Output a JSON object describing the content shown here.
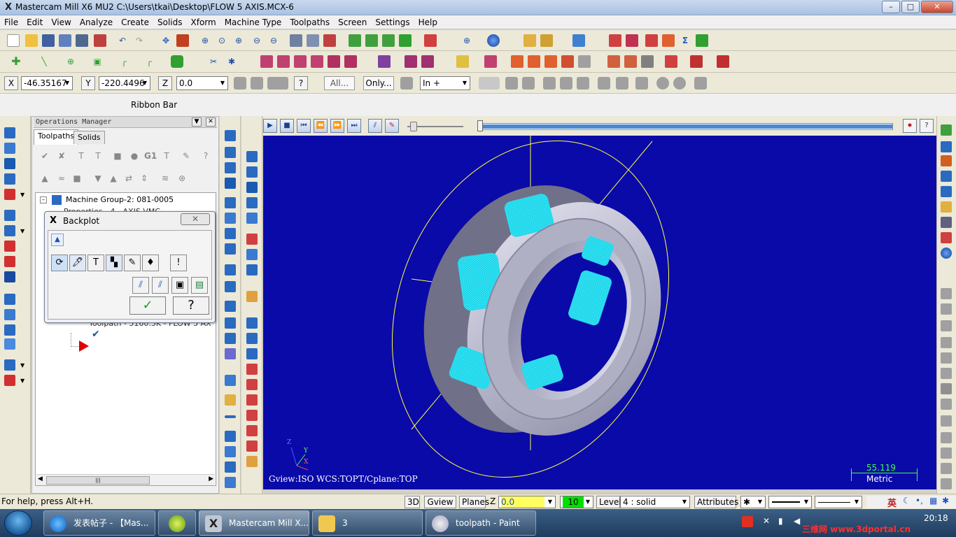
{
  "window": {
    "title": "Mastercam Mill X6 MU2  C:\\Users\\tkai\\Desktop\\FLOW 5 AXIS.MCX-6",
    "minimize": "–",
    "maximize": "□",
    "close": "✕"
  },
  "menu": [
    "File",
    "Edit",
    "View",
    "Analyze",
    "Create",
    "Solids",
    "Xform",
    "Machine Type",
    "Toolpaths",
    "Screen",
    "Settings",
    "Help"
  ],
  "ribbon": {
    "x_label": "X",
    "x_value": "-46.35167",
    "y_label": "Y",
    "y_value": "-220.4496",
    "z_label": "Z",
    "z_value": "0.0",
    "all_button": "All...",
    "only_button": "Only...",
    "mode_value": "In +",
    "help_icon": "?"
  },
  "ribbon_bar_label": "Ribbon Bar",
  "ops_manager": {
    "title": "Operations Manager",
    "tabs": [
      "Toolpaths",
      "Solids"
    ],
    "tree": {
      "machine_group": "Machine Group-2: 081-0005",
      "properties": "Properties - 4 - AXIS VMC",
      "toolpath": "Toolpath - 5160.5K - FLOW 5 AX"
    }
  },
  "backplot": {
    "title": "Backplot",
    "close": "✕",
    "info": "!",
    "ok": "✓",
    "help": "?"
  },
  "viewport": {
    "gview": "Gview:ISO",
    "wcs": "WCS:TOP",
    "tcplane": "T/Cplane:TOP",
    "scale_value": "55.119",
    "scale_unit": "Metric",
    "axis_z": "Z",
    "axis_y": "Y",
    "axis_x": "X",
    "colors": {
      "background": "#0a0aa8",
      "part": "#c8c8d8",
      "toolpath": "#00e0f0",
      "boundary": "#ffff40"
    }
  },
  "statusbar": {
    "help": "For help, press Alt+H.",
    "btn_3d": "3D",
    "btn_gview": "Gview",
    "btn_planes": "Planes",
    "z_label": "Z",
    "z_value": "0.0",
    "color_value": "10",
    "level_label": "Level",
    "level_value": "4 : solid",
    "attributes": "Attributes",
    "point_style": "✱"
  },
  "taskbar": {
    "tasks": [
      {
        "label": "发表帖子 - 【Mas..."
      },
      {
        "label": ""
      },
      {
        "label": "Mastercam Mill X..."
      },
      {
        "label": "3"
      },
      {
        "label": "toolpath - Paint"
      }
    ],
    "clock": "20:18",
    "tray_text": "英",
    "watermark": "三维网 www.3dportal.cn"
  }
}
